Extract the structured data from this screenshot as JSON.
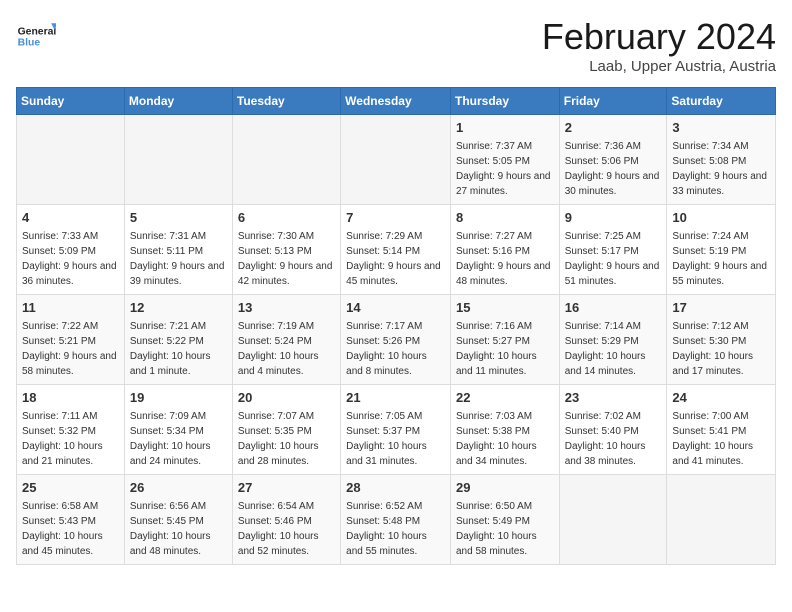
{
  "logo": {
    "text_general": "General",
    "text_blue": "Blue"
  },
  "title": {
    "month": "February 2024",
    "location": "Laab, Upper Austria, Austria"
  },
  "days_of_week": [
    "Sunday",
    "Monday",
    "Tuesday",
    "Wednesday",
    "Thursday",
    "Friday",
    "Saturday"
  ],
  "weeks": [
    [
      {
        "day": "",
        "info": ""
      },
      {
        "day": "",
        "info": ""
      },
      {
        "day": "",
        "info": ""
      },
      {
        "day": "",
        "info": ""
      },
      {
        "day": "1",
        "info": "Sunrise: 7:37 AM\nSunset: 5:05 PM\nDaylight: 9 hours and 27 minutes."
      },
      {
        "day": "2",
        "info": "Sunrise: 7:36 AM\nSunset: 5:06 PM\nDaylight: 9 hours and 30 minutes."
      },
      {
        "day": "3",
        "info": "Sunrise: 7:34 AM\nSunset: 5:08 PM\nDaylight: 9 hours and 33 minutes."
      }
    ],
    [
      {
        "day": "4",
        "info": "Sunrise: 7:33 AM\nSunset: 5:09 PM\nDaylight: 9 hours and 36 minutes."
      },
      {
        "day": "5",
        "info": "Sunrise: 7:31 AM\nSunset: 5:11 PM\nDaylight: 9 hours and 39 minutes."
      },
      {
        "day": "6",
        "info": "Sunrise: 7:30 AM\nSunset: 5:13 PM\nDaylight: 9 hours and 42 minutes."
      },
      {
        "day": "7",
        "info": "Sunrise: 7:29 AM\nSunset: 5:14 PM\nDaylight: 9 hours and 45 minutes."
      },
      {
        "day": "8",
        "info": "Sunrise: 7:27 AM\nSunset: 5:16 PM\nDaylight: 9 hours and 48 minutes."
      },
      {
        "day": "9",
        "info": "Sunrise: 7:25 AM\nSunset: 5:17 PM\nDaylight: 9 hours and 51 minutes."
      },
      {
        "day": "10",
        "info": "Sunrise: 7:24 AM\nSunset: 5:19 PM\nDaylight: 9 hours and 55 minutes."
      }
    ],
    [
      {
        "day": "11",
        "info": "Sunrise: 7:22 AM\nSunset: 5:21 PM\nDaylight: 9 hours and 58 minutes."
      },
      {
        "day": "12",
        "info": "Sunrise: 7:21 AM\nSunset: 5:22 PM\nDaylight: 10 hours and 1 minute."
      },
      {
        "day": "13",
        "info": "Sunrise: 7:19 AM\nSunset: 5:24 PM\nDaylight: 10 hours and 4 minutes."
      },
      {
        "day": "14",
        "info": "Sunrise: 7:17 AM\nSunset: 5:26 PM\nDaylight: 10 hours and 8 minutes."
      },
      {
        "day": "15",
        "info": "Sunrise: 7:16 AM\nSunset: 5:27 PM\nDaylight: 10 hours and 11 minutes."
      },
      {
        "day": "16",
        "info": "Sunrise: 7:14 AM\nSunset: 5:29 PM\nDaylight: 10 hours and 14 minutes."
      },
      {
        "day": "17",
        "info": "Sunrise: 7:12 AM\nSunset: 5:30 PM\nDaylight: 10 hours and 17 minutes."
      }
    ],
    [
      {
        "day": "18",
        "info": "Sunrise: 7:11 AM\nSunset: 5:32 PM\nDaylight: 10 hours and 21 minutes."
      },
      {
        "day": "19",
        "info": "Sunrise: 7:09 AM\nSunset: 5:34 PM\nDaylight: 10 hours and 24 minutes."
      },
      {
        "day": "20",
        "info": "Sunrise: 7:07 AM\nSunset: 5:35 PM\nDaylight: 10 hours and 28 minutes."
      },
      {
        "day": "21",
        "info": "Sunrise: 7:05 AM\nSunset: 5:37 PM\nDaylight: 10 hours and 31 minutes."
      },
      {
        "day": "22",
        "info": "Sunrise: 7:03 AM\nSunset: 5:38 PM\nDaylight: 10 hours and 34 minutes."
      },
      {
        "day": "23",
        "info": "Sunrise: 7:02 AM\nSunset: 5:40 PM\nDaylight: 10 hours and 38 minutes."
      },
      {
        "day": "24",
        "info": "Sunrise: 7:00 AM\nSunset: 5:41 PM\nDaylight: 10 hours and 41 minutes."
      }
    ],
    [
      {
        "day": "25",
        "info": "Sunrise: 6:58 AM\nSunset: 5:43 PM\nDaylight: 10 hours and 45 minutes."
      },
      {
        "day": "26",
        "info": "Sunrise: 6:56 AM\nSunset: 5:45 PM\nDaylight: 10 hours and 48 minutes."
      },
      {
        "day": "27",
        "info": "Sunrise: 6:54 AM\nSunset: 5:46 PM\nDaylight: 10 hours and 52 minutes."
      },
      {
        "day": "28",
        "info": "Sunrise: 6:52 AM\nSunset: 5:48 PM\nDaylight: 10 hours and 55 minutes."
      },
      {
        "day": "29",
        "info": "Sunrise: 6:50 AM\nSunset: 5:49 PM\nDaylight: 10 hours and 58 minutes."
      },
      {
        "day": "",
        "info": ""
      },
      {
        "day": "",
        "info": ""
      }
    ]
  ]
}
